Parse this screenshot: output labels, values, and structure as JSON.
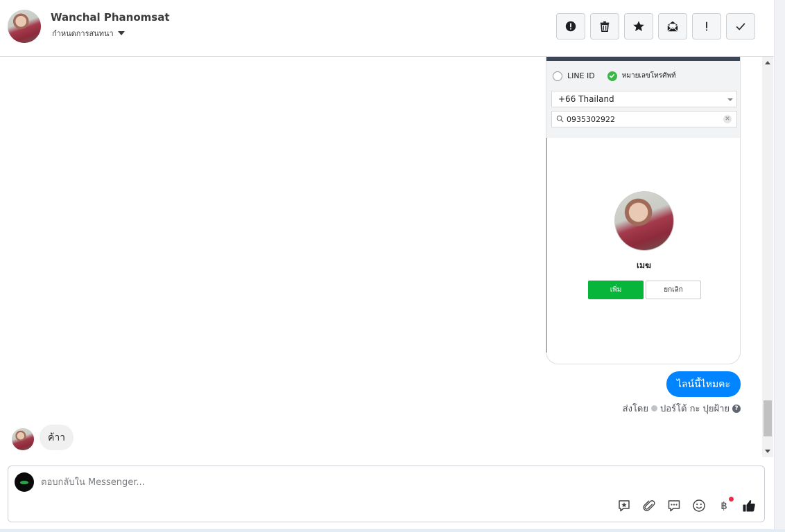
{
  "header": {
    "contact_name": "Wanchal Phanomsat",
    "subtitle": "กำหนดการสนทนา",
    "actions": [
      {
        "name": "report-spam-button",
        "icon": "alert-circle-icon"
      },
      {
        "name": "delete-button",
        "icon": "trash-icon"
      },
      {
        "name": "star-button",
        "icon": "star-icon"
      },
      {
        "name": "mark-unread-button",
        "icon": "envelope-open-icon"
      },
      {
        "name": "follow-up-button",
        "icon": "exclamation-icon"
      },
      {
        "name": "mark-done-button",
        "icon": "check-icon"
      }
    ]
  },
  "screenshot": {
    "radio_1": "LINE ID",
    "radio_2": "หมายเลขโทรศัพท์",
    "country": "+66  Thailand",
    "phone": "0935302922",
    "profile_name": "เมฆ",
    "add_button": "เพิ่ม",
    "cancel_button": "ยกเลิก"
  },
  "messages": {
    "outgoing_text": "ไลน์นี้ไหมคะ",
    "sent_by_prefix": "ส่งโดย",
    "sent_by_name": "ปอร์โต้ กะ ปุยฝ้าย",
    "incoming_text": "ค้าา"
  },
  "composer": {
    "placeholder": "ตอบกลับใน Messenger...",
    "baht_symbol": "฿"
  },
  "colors": {
    "messenger_blue": "#0084ff",
    "line_green": "#07b53b",
    "check_green": "#3cb648",
    "notification_red": "#f0284a"
  }
}
